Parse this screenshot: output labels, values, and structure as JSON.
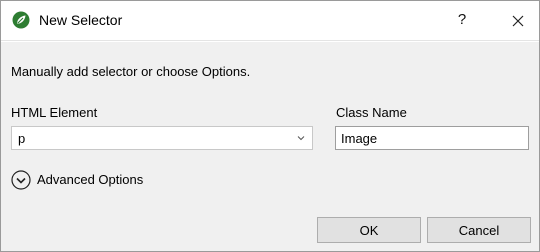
{
  "window": {
    "title": "New Selector",
    "help_glyph": "?",
    "icons": {
      "app": "leaf-logo-icon",
      "close": "close-icon"
    }
  },
  "dialog": {
    "intro": "Manually add selector or choose Options.",
    "html_element": {
      "label": "HTML Element",
      "value": "p"
    },
    "class_name": {
      "label": "Class Name",
      "value": "Image"
    },
    "advanced": {
      "label": "Advanced Options",
      "icon": "chevron-down-circle-icon"
    },
    "buttons": {
      "ok": "OK",
      "cancel": "Cancel"
    }
  },
  "colors": {
    "accent": "#2e7d32",
    "dialog_bg": "#f0f0f0",
    "button_bg": "#e1e1e1"
  }
}
